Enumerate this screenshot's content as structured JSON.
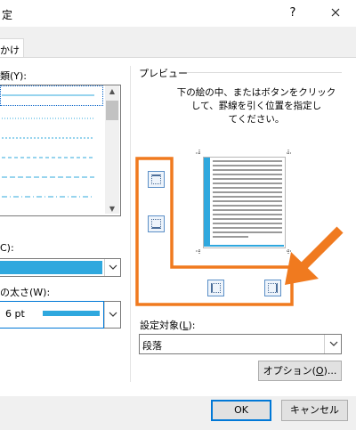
{
  "window": {
    "title_fragment": "定",
    "help_label": "?",
    "close_label": "✕"
  },
  "tabs": {
    "active_fragment": "かけ"
  },
  "left": {
    "style_label": "類(Y):",
    "color_label": "C):",
    "width_label": "の太さ(W):",
    "width_value": "6 pt",
    "accent_color": "#2fa8de"
  },
  "preview": {
    "group_title": "プレビュー",
    "hint_lines": [
      "下の絵の中、またはボタンをクリック",
      "して、罫線を引く位置を指定し",
      "てください。"
    ],
    "apply_label_main": "設定対象(",
    "apply_label_key": "L",
    "apply_label_end": "):",
    "apply_value": "段落",
    "options_main": "オプション(",
    "options_key": "O",
    "options_end": ")..."
  },
  "footer": {
    "ok_label": "OK",
    "cancel_label": "キャンセル"
  },
  "annotation": {
    "color": "#f07a1f"
  }
}
